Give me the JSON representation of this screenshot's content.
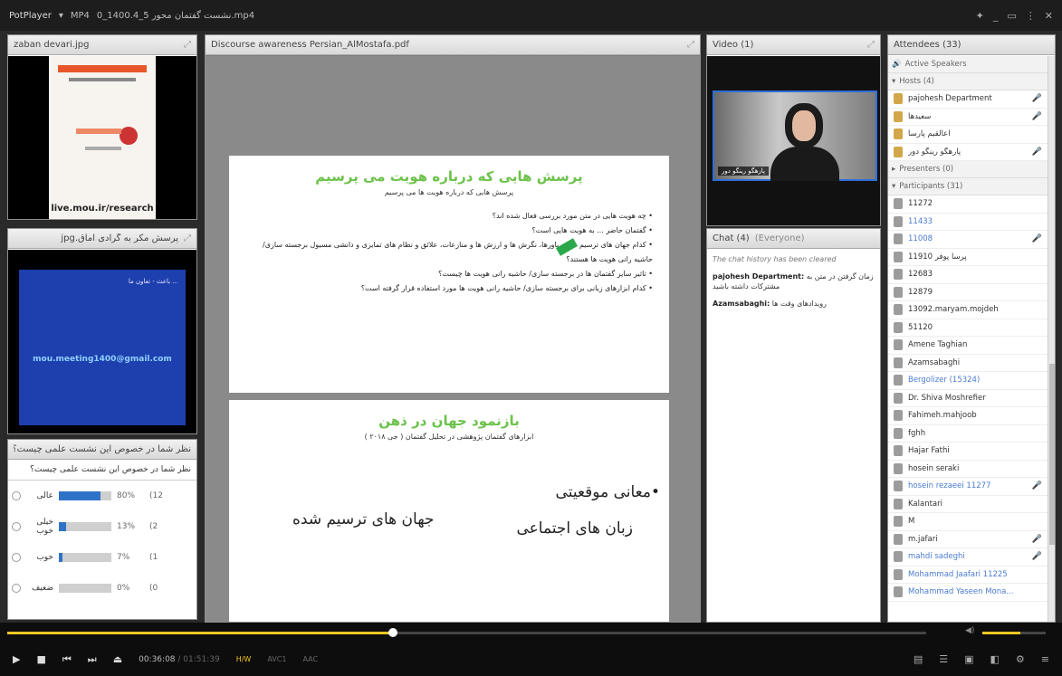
{
  "titlebar": {
    "app": "PotPlayer",
    "format": "MP4",
    "filename": "نشست گفتمان محور 5_1400.4_0.mp4",
    "controls": [
      "pin-icon",
      "minimize-icon",
      "restore-icon",
      "settings-icon",
      "close-icon"
    ]
  },
  "pods": {
    "image1": {
      "title": "zaban devari.jpg",
      "poster_label": "live.mou.ir/research"
    },
    "image2": {
      "title": "پرسش مکر به گرادی اماق.jpg",
      "card_text": "باعث - تعاون ما ... ",
      "card_email": "mou.meeting1400@gmail.com"
    },
    "poll": {
      "title": "نظر شما در خصوص این نشست علمی چیست؟",
      "question": "نظر شما در خصوص این نشست علمی چیست؟",
      "options": [
        {
          "label": "عالی",
          "percent": "80%",
          "count": "(12",
          "fraction": 0.8
        },
        {
          "label": "خیلی خوب",
          "percent": "13%",
          "count": "(2",
          "fraction": 0.13
        },
        {
          "label": "خوب",
          "percent": "7%",
          "count": "(1",
          "fraction": 0.07
        },
        {
          "label": "ضعیف",
          "percent": "0%",
          "count": "(0",
          "fraction": 0.0
        }
      ]
    },
    "document": {
      "title": "Discourse awareness Persian_AlMostafa.pdf",
      "slide1": {
        "title": "پرسش هایی که درباره هویت می پرسیم",
        "subtitle": "پرسش هایی که درباره هویت ها می پرسیم",
        "items": [
          "چه هویت هایی در متن مورد بررسی فعال شده اند؟",
          "گفتمان حاضر ... به هویت هایی است؟",
          "کدام جهان های ترسیم شده، باورها، نگرش ها و ارزش ها و منازعات، علائق و نظام های تمایزی و دانشی مسیول برجسته سازی/حاشیه رانی هویت ها هستند؟",
          "تاثیر سایر گفتمان ها در برجسته سازی/ حاشیه رانی هویت ها چیست؟",
          "کدام ابزارهای زبانی برای برجسته سازی/ حاشیه رانی هویت ها مورد استفاده قرار گرفته است؟"
        ]
      },
      "slide2": {
        "title": "بازنمود جهان در ذهن",
        "subtitle": "ابزارهای گفتمان پژوهشی در تحلیل گفتمان ( جی ۲۰۱۸ )",
        "item1": "•معانی موقعیتی",
        "item2": "زبان های اجتماعی",
        "item3": "جهان های ترسیم شده"
      }
    },
    "video": {
      "title": "Video (1)",
      "caption": "پارهگو رینگو دور"
    },
    "chat": {
      "title": "Chat (4)",
      "scope": "(Everyone)",
      "note": "The chat history has been cleared",
      "messages": [
        {
          "sender": "pajohesh Department:",
          "text": "زمان گرفتن در متن به مشترکات داشته باشید"
        },
        {
          "sender": "Azamsabaghi:",
          "text": "رویدادهای وقت ها"
        }
      ]
    },
    "attendees": {
      "title": "Attendees (33)",
      "active_speakers": "Active Speakers",
      "hosts_header": "Hosts (4)",
      "hosts": [
        {
          "name": "pajohesh Department",
          "mic": "red"
        },
        {
          "name": "سعیدها",
          "mic": "red"
        },
        {
          "name": "اعالقیم پارسا",
          "mic": ""
        },
        {
          "name": "پارهگو رینگو دور",
          "mic": "grey"
        }
      ],
      "presenters_header": "Presenters (0)",
      "participants_header": "Participants (31)",
      "participants": [
        {
          "name": "11272",
          "blue": false,
          "mic": ""
        },
        {
          "name": "11433",
          "blue": true,
          "mic": ""
        },
        {
          "name": "11008",
          "blue": true,
          "mic": "grey"
        },
        {
          "name": "11910 پرسا پوفر",
          "blue": false,
          "mic": ""
        },
        {
          "name": "12683",
          "blue": false,
          "mic": ""
        },
        {
          "name": "12879",
          "blue": false,
          "mic": ""
        },
        {
          "name": "13092.maryam.mojdeh",
          "blue": false,
          "mic": ""
        },
        {
          "name": "51120",
          "blue": false,
          "mic": ""
        },
        {
          "name": "Amene Taghian",
          "blue": false,
          "mic": ""
        },
        {
          "name": "Azamsabaghi",
          "blue": false,
          "mic": ""
        },
        {
          "name": "Bergolizer (15324)",
          "blue": true,
          "mic": ""
        },
        {
          "name": "Dr. Shiva Moshrefier",
          "blue": false,
          "mic": ""
        },
        {
          "name": "Fahimeh.mahjoob",
          "blue": false,
          "mic": ""
        },
        {
          "name": "fghh",
          "blue": false,
          "mic": ""
        },
        {
          "name": "Hajar Fathi",
          "blue": false,
          "mic": ""
        },
        {
          "name": "hosein seraki",
          "blue": false,
          "mic": ""
        },
        {
          "name": "hosein rezaeei 11277",
          "blue": true,
          "mic": "grey"
        },
        {
          "name": "Kalantari",
          "blue": false,
          "mic": ""
        },
        {
          "name": "M",
          "blue": false,
          "mic": ""
        },
        {
          "name": "m.jafari",
          "blue": false,
          "mic": "grey"
        },
        {
          "name": "mahdi sadeghi",
          "blue": true,
          "mic": "grey"
        },
        {
          "name": "Mohammad Jaafari 11225",
          "blue": true,
          "mic": ""
        },
        {
          "name": "Mohammad Yaseen Mona...",
          "blue": true,
          "mic": ""
        }
      ]
    }
  },
  "player": {
    "seek_fraction": 0.42,
    "volume_fraction": 0.6,
    "time_current": "00:36:08",
    "time_total": "/ 01:51:39",
    "tags": [
      "H/W",
      "AVC1",
      "AAC"
    ],
    "accent": "#f3c623"
  }
}
